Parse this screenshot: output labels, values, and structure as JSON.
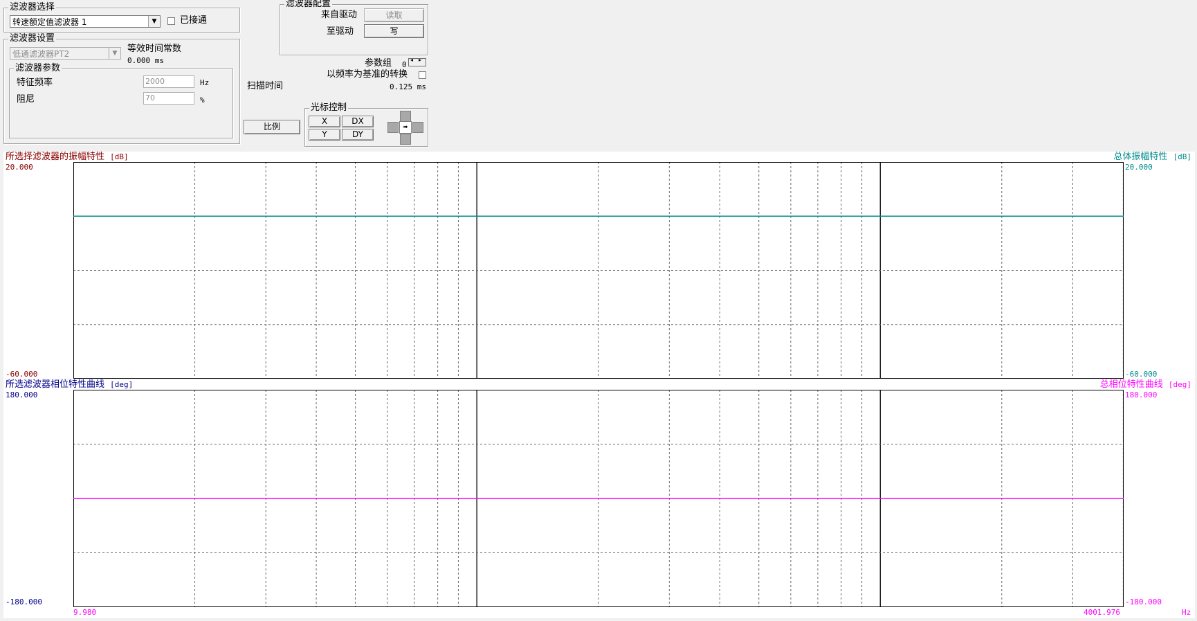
{
  "filter_select": {
    "legend": "滤波器选择",
    "selected": "转速额定值滤波器 1",
    "connected_label": "已接通",
    "connected": false
  },
  "filter_config": {
    "legend": "滤波器配置",
    "from_drive_label": "来自驱动",
    "read_button": "读取",
    "to_drive_label": "至驱动",
    "write_button": "写"
  },
  "filter_settings": {
    "legend": "滤波器设置",
    "type": "低通滤波器PT2",
    "equiv_time_label": "等效时间常数",
    "equiv_time_value": "0.000 ms",
    "params": {
      "legend": "滤波器参数",
      "freq_label": "特征频率",
      "freq_value": "2000",
      "freq_unit": "Hz",
      "damping_label": "阻尼",
      "damping_value": "70",
      "damping_unit": "%"
    }
  },
  "misc": {
    "param_group_label": "参数组",
    "param_group_value": "0",
    "freq_based_label": "以频率为基准的转换",
    "freq_based": false,
    "scan_time_label": "扫描时间",
    "scan_time_value": "0.125 ms",
    "scale_button": "比例"
  },
  "cursor": {
    "legend": "光标控制",
    "x": "X",
    "dx": "DX",
    "y": "Y",
    "dy": "DY"
  },
  "colors": {
    "amp_title": "#8b0000",
    "phase_title": "#00008b",
    "total_amp": "#008b8b",
    "total_phase": "#ff00ff"
  },
  "chart_data": [
    {
      "type": "line",
      "title_left": "所选择滤波器的振幅特性",
      "unit_left": "[dB]",
      "title_right": "总体振幅特性",
      "unit_right": "[dB]",
      "y_max_label": "20.000",
      "y_min_label": "-60.000",
      "ylim": [
        -60,
        20
      ],
      "xlim": [
        9.98,
        4001.976
      ],
      "x_scale": "log",
      "grid": true,
      "series": [
        {
          "name": "总体振幅特性",
          "color": "#008b8b",
          "x": [
            9.98,
            4001.976
          ],
          "y": [
            0,
            0
          ]
        }
      ]
    },
    {
      "type": "line",
      "title_left": "所选滤波器相位特性曲线",
      "unit_left": "[deg]",
      "title_right": "总相位特性曲线",
      "unit_right": "[deg]",
      "y_max_label": "180.000",
      "y_min_label": "-180.000",
      "ylim": [
        -180,
        180
      ],
      "xlim": [
        9.98,
        4001.976
      ],
      "x_scale": "log",
      "grid": true,
      "x_min_label": "9.980",
      "x_max_label": "4001.976",
      "x_unit": "Hz",
      "series": [
        {
          "name": "总相位特性曲线",
          "color": "#ff00ff",
          "x": [
            9.98,
            4001.976
          ],
          "y": [
            0,
            0
          ]
        }
      ]
    }
  ]
}
